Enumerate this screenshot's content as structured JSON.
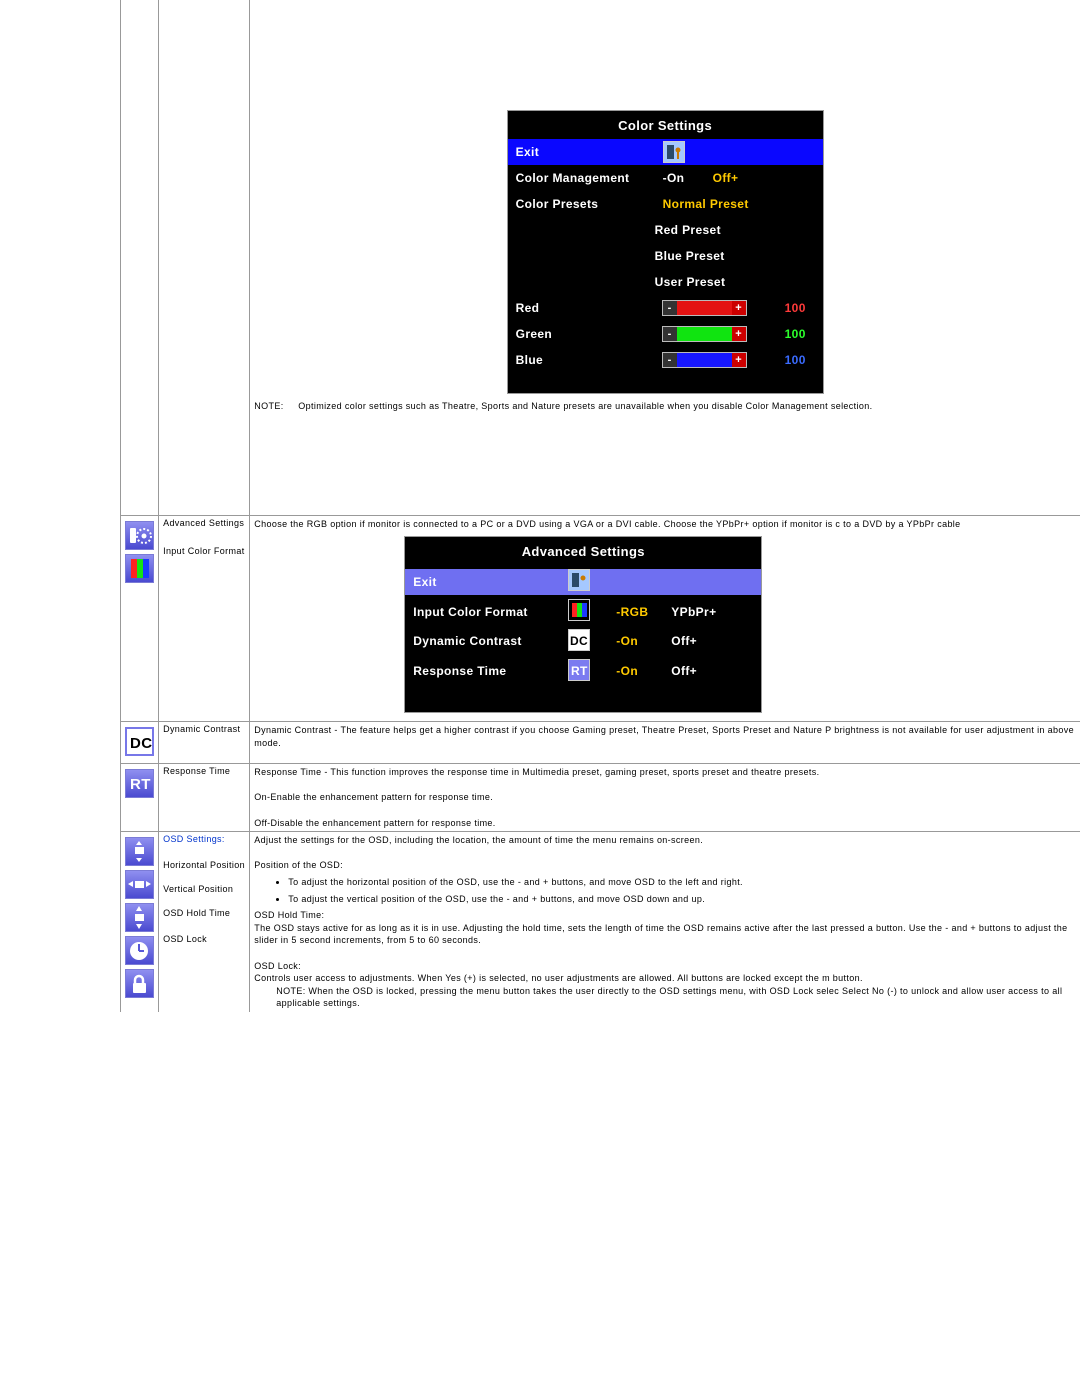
{
  "color_settings": {
    "title": "Color Settings",
    "exit": "Exit",
    "management": {
      "label": "Color Management",
      "opt1": "-On",
      "opt2": "Off+"
    },
    "presets_label": "Color Presets",
    "presets": [
      "Normal Preset",
      "Red Preset",
      "Blue Preset",
      "User Preset"
    ],
    "channels": [
      {
        "name": "Red",
        "value": "100",
        "color": "#e41313",
        "numcolor": "#ff3a3a"
      },
      {
        "name": "Green",
        "value": "100",
        "color": "#10e410",
        "numcolor": "#2cff2c"
      },
      {
        "name": "Blue",
        "value": "100",
        "color": "#1717ff",
        "numcolor": "#3a6bff"
      }
    ],
    "note_label": "NOTE:",
    "note": "Optimized color settings such as Theatre, Sports and Nature presets are unavailable when you disable Color Management selection."
  },
  "advanced": {
    "row_label": "Advanced Settings",
    "input_label": "Input Color Format",
    "intro": "Choose the RGB option if monitor is connected to a PC or a DVD using a VGA or a DVI cable. Choose the YPbPr+ option if monitor is c to a DVD by a YPbPr cable",
    "osd_title": "Advanced Settings",
    "exit": "Exit",
    "rows": [
      {
        "label": "Input Color Format",
        "o1": "-RGB",
        "o2": "YPbPr+",
        "icon": "rgb"
      },
      {
        "label": "Dynamic Contrast",
        "o1": "-On",
        "o2": "Off+",
        "icon": "dc"
      },
      {
        "label": "Response Time",
        "o1": "-On",
        "o2": "Off+",
        "icon": "rt"
      }
    ]
  },
  "dc": {
    "label": "Dynamic Contrast",
    "text": "Dynamic Contrast - The feature helps get a higher contrast if you choose Gaming preset, Theatre Preset, Sports Preset and Nature P brightness is not available for user adjustment in above mode."
  },
  "rt": {
    "label": "Response Time",
    "p1": "Response Time - This function improves the response time in Multimedia preset, gaming preset, sports preset and theatre presets.",
    "p2": "On-Enable the enhancement pattern for response time.",
    "p3": "Off-Disable the enhancement pattern for response time."
  },
  "osd": {
    "label": "OSD Settings:",
    "hp": "Horizontal Position",
    "vp": "Vertical Position",
    "hold": "OSD Hold Time",
    "lock": "OSD Lock",
    "intro": "Adjust the settings for the OSD, including the location, the amount of time the menu remains on-screen.",
    "pos_lbl": "Position of the OSD:",
    "b1": "To adjust the horizontal position of the OSD, use the - and + buttons, and move OSD to the left and right.",
    "b2": "To adjust the vertical position of the OSD, use the - and + buttons, and move OSD down and up.",
    "hold_lbl": "OSD Hold Time:",
    "hold_text": "The OSD stays active for as long as it is in use. Adjusting the hold time, sets the length of time the OSD remains active after the last pressed a button. Use the - and + buttons to adjust the slider in 5 second increments, from 5 to 60 seconds.",
    "lock_lbl": "OSD Lock:",
    "lock_text": "Controls user access to adjustments. When Yes (+) is selected, no user adjustments are allowed. All buttons are locked except the m button.",
    "lock_note": "NOTE: When the OSD is locked, pressing the menu button takes the user directly to the OSD settings menu, with OSD Lock selec Select No (-) to unlock and allow user access to all applicable settings."
  }
}
